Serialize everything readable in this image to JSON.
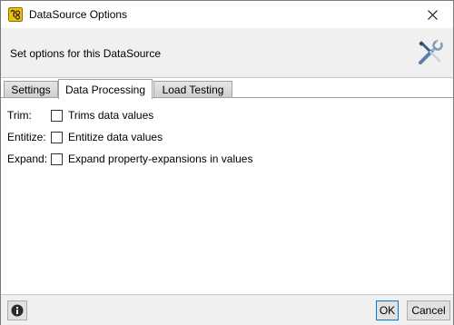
{
  "window": {
    "title": "DataSource Options",
    "icon": "soapui-app-icon",
    "close_icon": "close-icon"
  },
  "header": {
    "description": "Set options for this DataSource",
    "icon": "tools-icon"
  },
  "tabs": [
    {
      "label": "Settings",
      "active": false
    },
    {
      "label": "Data Processing",
      "active": true
    },
    {
      "label": "Load Testing",
      "active": false
    }
  ],
  "options": [
    {
      "label": "Trim:",
      "checkbox_label": "Trims data values",
      "checked": false
    },
    {
      "label": "Entitize:",
      "checkbox_label": "Entitize data values",
      "checked": false
    },
    {
      "label": "Expand:",
      "checkbox_label": "Expand property-expansions in values",
      "checked": false
    }
  ],
  "footer": {
    "info_icon": "info-icon",
    "ok_label": "OK",
    "cancel_label": "Cancel"
  },
  "colors": {
    "header_bg": "#f0f0f0",
    "accent_border": "#0078d7",
    "icon_yellow": "#f2c100"
  }
}
